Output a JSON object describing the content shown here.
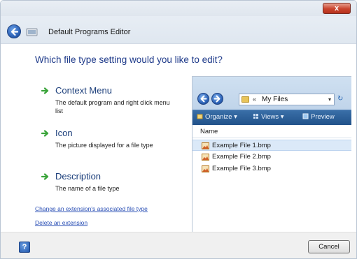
{
  "window": {
    "title": "Default Programs Editor",
    "close_label": "x"
  },
  "main": {
    "question": "Which file type setting would you like to edit?",
    "options": [
      {
        "title": "Context Menu",
        "description": "The default program and right click menu list"
      },
      {
        "title": "Icon",
        "description": "The picture displayed for a file type"
      },
      {
        "title": "Description",
        "description": "The name of a file type"
      }
    ],
    "links": [
      "Change an extension's associated file type",
      "Delete an extension"
    ]
  },
  "preview": {
    "address_chevron": "«",
    "address": "My Files",
    "dropdown": "▾",
    "refresh": "↻",
    "toolbar": {
      "organize": "Organize ▾",
      "views": "Views ▾",
      "preview": "Preview"
    },
    "column_header": "Name",
    "files": [
      "Example File 1.bmp",
      "Example File 2.bmp",
      "Example File 3.bmp"
    ]
  },
  "footer": {
    "help_label": "?",
    "cancel_label": "Cancel"
  },
  "icons": {
    "back": "back-arrow-icon",
    "program": "program-icon",
    "option_arrow": "green-arrow-icon",
    "file": "image-file-icon",
    "help": "help-icon"
  },
  "colors": {
    "link": "#2a4fb5",
    "heading": "#1e3a8a",
    "arrow": "#3aa43a",
    "toolbar": "#21528a"
  }
}
